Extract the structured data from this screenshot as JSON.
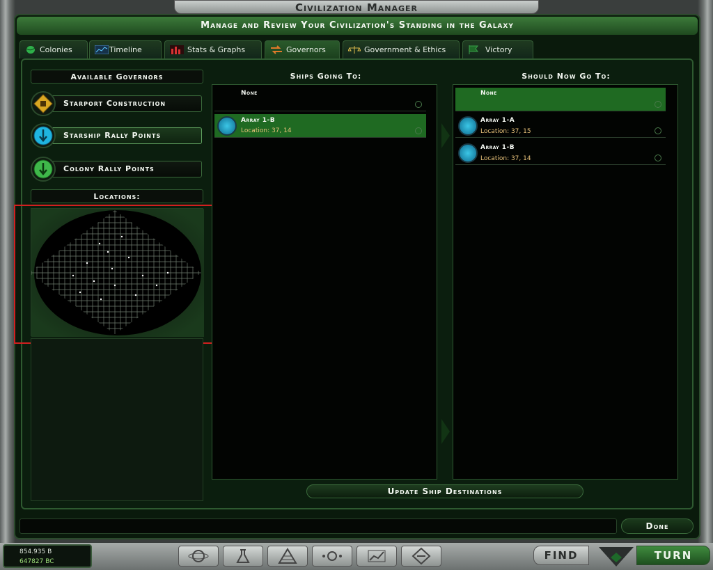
{
  "window": {
    "title": "Civilization Manager",
    "subtitle": "Manage and Review Your Civilization's Standing in the Galaxy"
  },
  "tabs": [
    {
      "label": "Colonies",
      "icon": "planet-icon"
    },
    {
      "label": "Timeline",
      "icon": "timeline-icon"
    },
    {
      "label": "Stats & Graphs",
      "icon": "bar-chart-icon"
    },
    {
      "label": "Governors",
      "icon": "arrows-icon",
      "active": true
    },
    {
      "label": "Government & Ethics",
      "icon": "scales-icon"
    },
    {
      "label": "Victory",
      "icon": "flag-icon"
    }
  ],
  "left": {
    "available_governors": "Available Governors",
    "governors": [
      {
        "label": "Starport Construction",
        "icon": "starport-icon",
        "color": "#d9a722"
      },
      {
        "label": "Starship Rally Points",
        "icon": "starship-rally-icon",
        "color": "#1fb4e0",
        "selected": true
      },
      {
        "label": "Colony Rally Points",
        "icon": "colony-rally-icon",
        "color": "#3fb84a"
      }
    ],
    "locations": "Locations:"
  },
  "middle": {
    "header": "Ships Going To:",
    "rows": [
      {
        "name": "None"
      },
      {
        "name": "Array 1-B",
        "location": "Location: 37, 14",
        "selected": true
      }
    ]
  },
  "right": {
    "header": "Should Now Go To:",
    "rows": [
      {
        "name": "None",
        "selected": true
      },
      {
        "name": "Array 1-A",
        "location": "Location: 37, 15"
      },
      {
        "name": "Array 1-B",
        "location": "Location: 37, 14"
      }
    ]
  },
  "actions": {
    "update": "Update Ship Destinations",
    "done": "Done",
    "find": "FIND",
    "turn": "TURN"
  },
  "status": {
    "credits": "854.935 B",
    "bc": "647827 BC"
  },
  "colors": {
    "accent": "#2f5a31",
    "highlight": "#2a7a2b",
    "location": "#e8c27a"
  }
}
